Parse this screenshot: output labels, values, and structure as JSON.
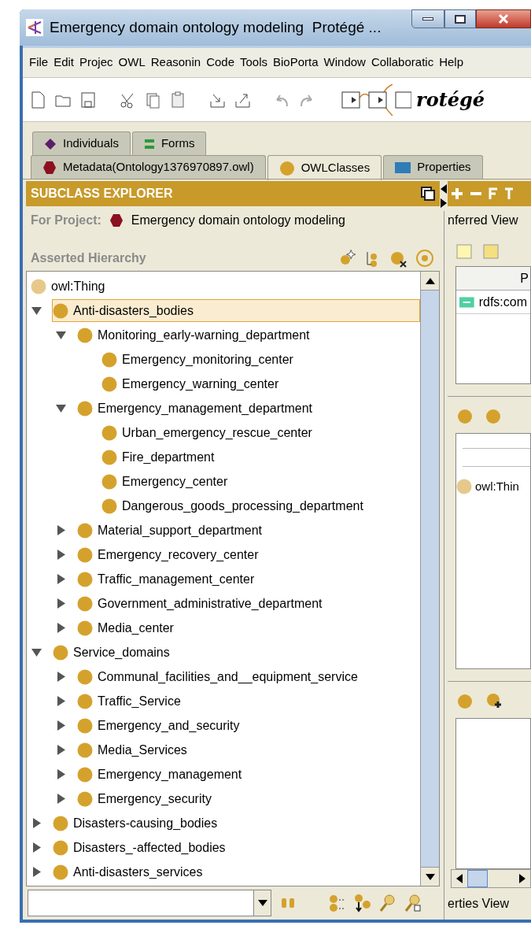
{
  "window": {
    "title": "Emergency domain ontology modeling  Protégé ..."
  },
  "menu": [
    "File",
    "Edit",
    "Projec",
    "OWL",
    "Reasonin",
    "Code",
    "Tools",
    "BioPorta",
    "Window",
    "Collaboratic",
    "Help"
  ],
  "logo_text": "rotégé",
  "tab_rows": [
    [
      {
        "label": "Individuals",
        "selected": false
      },
      {
        "label": "Forms",
        "selected": false
      }
    ],
    [
      {
        "label": "Metadata(Ontology1376970897.owl)",
        "selected": false
      },
      {
        "label": "OWLClasses",
        "selected": true
      },
      {
        "label": "Properties",
        "selected": false
      }
    ]
  ],
  "explorer": {
    "title": "SUBCLASS EXPLORER",
    "project_label": "For Project:",
    "project_name": "Emergency domain ontology modeling",
    "hierarchy_label": "Asserted Hierarchy",
    "tree": [
      {
        "label": "owl:Thing",
        "kind": "thing",
        "selected": false,
        "children": [
          {
            "label": "Anti-disasters_bodies",
            "kind": "class",
            "expanded": true,
            "selected": true,
            "children": [
              {
                "label": "Monitoring_early-warning_department",
                "kind": "class",
                "expanded": true,
                "selected": false,
                "children": [
                  {
                    "label": "Emergency_monitoring_center",
                    "kind": "class",
                    "selected": false
                  },
                  {
                    "label": "Emergency_warning_center",
                    "kind": "class",
                    "selected": false
                  }
                ]
              },
              {
                "label": "Emergency_management_department",
                "kind": "class",
                "expanded": true,
                "selected": false,
                "children": [
                  {
                    "label": "Urban_emergency_rescue_center",
                    "kind": "class",
                    "selected": false
                  },
                  {
                    "label": "Fire_department",
                    "kind": "class",
                    "selected": false
                  },
                  {
                    "label": "Emergency_center",
                    "kind": "class",
                    "selected": false
                  },
                  {
                    "label": "Dangerous_goods_processing_department",
                    "kind": "class",
                    "selected": false
                  }
                ]
              },
              {
                "label": "Material_support_department",
                "kind": "class",
                "expanded": false,
                "selected": false
              },
              {
                "label": "Emergency_recovery_center",
                "kind": "class",
                "expanded": false,
                "selected": false
              },
              {
                "label": "Traffic_management_center",
                "kind": "class",
                "expanded": false,
                "selected": false
              },
              {
                "label": "Government_administrative_department",
                "kind": "class",
                "expanded": false,
                "selected": false
              },
              {
                "label": "Media_center",
                "kind": "class",
                "expanded": false,
                "selected": false
              }
            ]
          },
          {
            "label": "Service_domains",
            "kind": "class",
            "expanded": true,
            "selected": false,
            "children": [
              {
                "label": "Communal_facilities_and__equipment_service",
                "kind": "class",
                "expanded": false,
                "selected": false
              },
              {
                "label": "Traffic_Service",
                "kind": "class",
                "expanded": false,
                "selected": false
              },
              {
                "label": "Emergency_and_security",
                "kind": "class",
                "expanded": false,
                "selected": false
              },
              {
                "label": "Media_Services",
                "kind": "class",
                "expanded": false,
                "selected": false
              },
              {
                "label": "Emergency_management",
                "kind": "class",
                "expanded": false,
                "selected": false
              },
              {
                "label": "Emergency_security",
                "kind": "class",
                "expanded": false,
                "selected": false
              }
            ]
          },
          {
            "label": "Disasters-causing_bodies",
            "kind": "class",
            "expanded": false,
            "selected": false
          },
          {
            "label": "Disasters_-affected_bodies",
            "kind": "class",
            "expanded": false,
            "selected": false
          },
          {
            "label": "Anti-disasters_services",
            "kind": "class",
            "expanded": false,
            "selected": false
          }
        ]
      }
    ]
  },
  "side": {
    "toolbar_label": "nferred View",
    "table_header": "P",
    "table_row": "rdfs:com",
    "superclass": "owl:Thin",
    "footer": "erties View"
  }
}
